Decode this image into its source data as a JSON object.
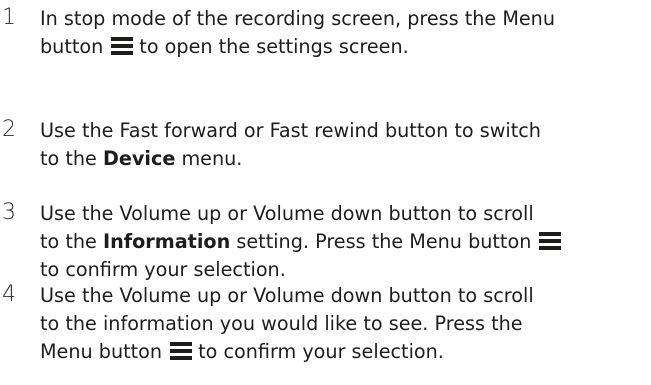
{
  "steps": [
    {
      "number": "1",
      "line1": "In stop mode of the recording screen, press the Menu",
      "line2_before": "button",
      "line2_after": "to open the settings screen."
    },
    {
      "number": "2",
      "line1": "Use the Fast forward or Fast rewind button to switch",
      "line2_before": "to the ",
      "line2_bold": "Device",
      "line2_after": " menu."
    },
    {
      "number": "3",
      "line1": "Use the Volume up or Volume down button to scroll",
      "line2_before": "to the ",
      "line2_bold": "Information",
      "line2_after": " setting. Press the Menu button",
      "line3": "to confirm your selection."
    },
    {
      "number": "4",
      "line1": "Use the Volume up or Volume down button to scroll",
      "line2": "to the information you would like to see. Press the",
      "line3_before": "Menu button",
      "line3_after": "to confirm your selection."
    }
  ],
  "icons": {
    "menu": "menu-icon",
    "color": "#1d1d1b"
  }
}
